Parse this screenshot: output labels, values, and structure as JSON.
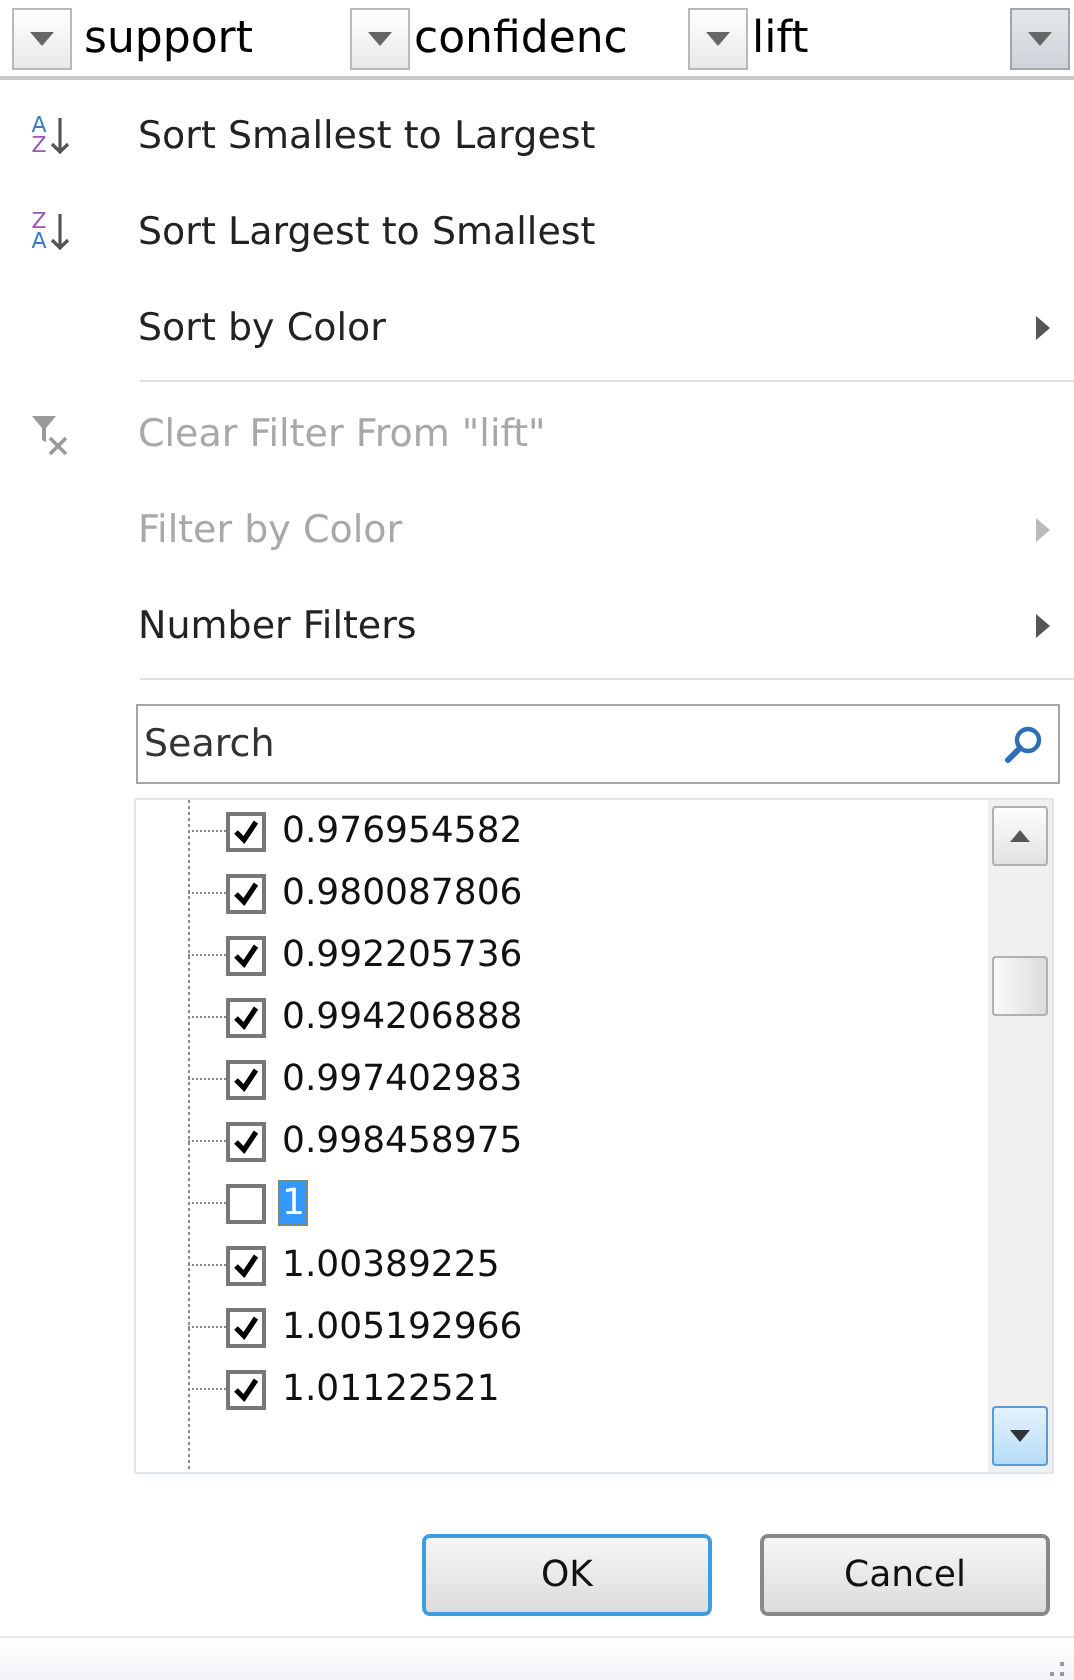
{
  "header": {
    "columns": [
      {
        "label": "support",
        "open": false
      },
      {
        "label": "confidenc",
        "open": false
      },
      {
        "label": "lift",
        "open": true
      }
    ]
  },
  "menu": [
    {
      "kind": "command",
      "icon_letters": [
        "A",
        "Z"
      ],
      "label": "Sort Smallest to Largest",
      "disabled": false
    },
    {
      "kind": "command",
      "icon_letters": [
        "Z",
        "A"
      ],
      "label": "Sort Largest to Smallest",
      "disabled": false
    },
    {
      "kind": "submenu",
      "label": "Sort by Color",
      "disabled": false
    },
    {
      "kind": "separator"
    },
    {
      "kind": "command",
      "label": "Clear Filter From \"lift\"",
      "disabled": true
    },
    {
      "kind": "submenu",
      "label": "Filter by Color",
      "disabled": true
    },
    {
      "kind": "submenu",
      "label": "Number Filters",
      "disabled": false
    },
    {
      "kind": "separator"
    }
  ],
  "search": {
    "placeholder": "Search"
  },
  "values": [
    {
      "label": "0.976954582",
      "checked": true,
      "selected": false
    },
    {
      "label": "0.980087806",
      "checked": true,
      "selected": false
    },
    {
      "label": "0.992205736",
      "checked": true,
      "selected": false
    },
    {
      "label": "0.994206888",
      "checked": true,
      "selected": false
    },
    {
      "label": "0.997402983",
      "checked": true,
      "selected": false
    },
    {
      "label": "0.998458975",
      "checked": true,
      "selected": false
    },
    {
      "label": "1",
      "checked": false,
      "selected": true
    },
    {
      "label": "1.00389225",
      "checked": true,
      "selected": false
    },
    {
      "label": "1.005192966",
      "checked": true,
      "selected": false
    },
    {
      "label": "1.01122521",
      "checked": true,
      "selected": false
    }
  ],
  "buttons": [
    {
      "label": "OK",
      "default": true
    },
    {
      "label": "Cancel",
      "default": false
    }
  ]
}
